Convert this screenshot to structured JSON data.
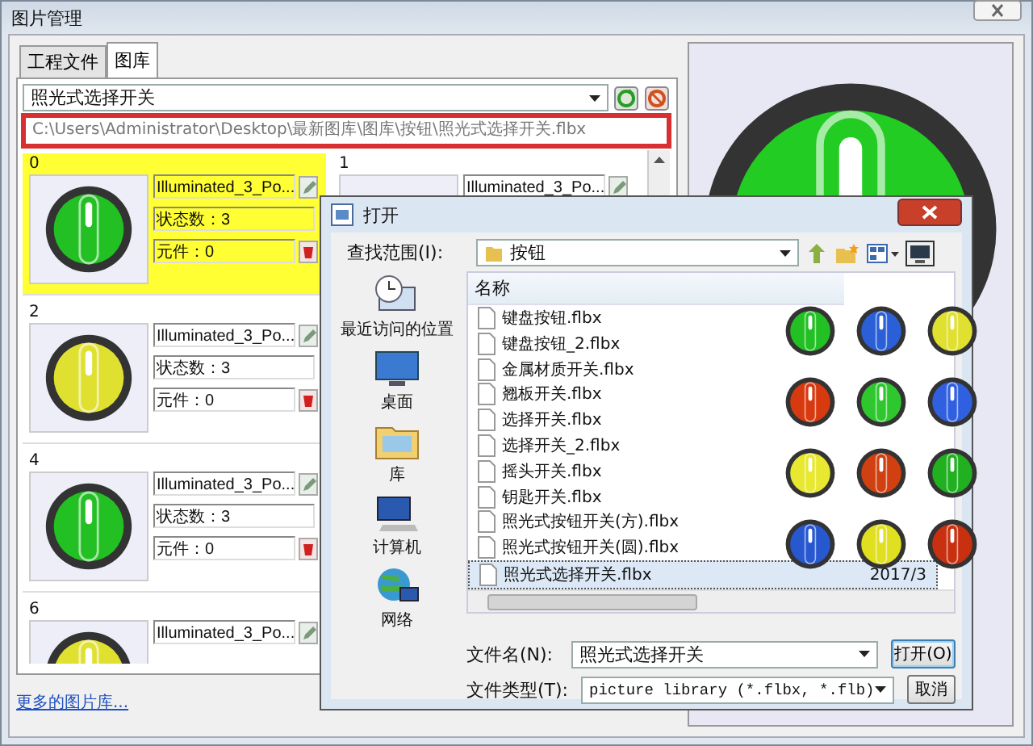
{
  "window": {
    "title": "图片管理"
  },
  "tabs": [
    {
      "label": "工程文件",
      "selected": false
    },
    {
      "label": "图库",
      "selected": true
    }
  ],
  "library": {
    "value": "照光式选择开关"
  },
  "path": {
    "value": "C:\\Users\\Administrator\\Desktop\\最新图库\\图库\\按钮\\照光式选择开关.flbx",
    "highlighted": true
  },
  "grid": {
    "columns": [
      {
        "items": [
          {
            "index": "0",
            "name": "Illuminated_3_Po...",
            "states": "状态数：3",
            "parts": "元件：0",
            "selected": true,
            "color": "#22c022"
          },
          {
            "index": "2",
            "name": "Illuminated_3_Po...",
            "states": "状态数：3",
            "parts": "元件：0",
            "selected": false,
            "color": "#e0e030"
          },
          {
            "index": "4",
            "name": "Illuminated_3_Po...",
            "states": "状态数：3",
            "parts": "元件：0",
            "selected": false,
            "color": "#22c022"
          },
          {
            "index": "6",
            "name": "Illuminated_3_Po...",
            "selected": false,
            "color": "#e0e030"
          }
        ]
      },
      {
        "items": [
          {
            "index": "1",
            "name": "Illuminated_3_Po...",
            "selected": false
          }
        ]
      }
    ]
  },
  "more_link": "更多的图片库...",
  "dialog": {
    "title": "打开",
    "look_in_label": "查找范围(I):",
    "look_in_value": "按钮",
    "places": [
      {
        "label": "最近访问的位置"
      },
      {
        "label": "桌面"
      },
      {
        "label": "库"
      },
      {
        "label": "计算机"
      },
      {
        "label": "网络"
      }
    ],
    "column_header": "名称",
    "files": [
      {
        "name": "键盘按钮.flbx",
        "selected": false
      },
      {
        "name": "键盘按钮_2.flbx",
        "selected": false
      },
      {
        "name": "金属材质开关.flbx",
        "selected": false
      },
      {
        "name": "翘板开关.flbx",
        "selected": false
      },
      {
        "name": "选择开关.flbx",
        "selected": false
      },
      {
        "name": "选择开关_2.flbx",
        "selected": false
      },
      {
        "name": "摇头开关.flbx",
        "selected": false
      },
      {
        "name": "钥匙开关.flbx",
        "selected": false
      },
      {
        "name": "照光式按钮开关(方).flbx",
        "selected": false
      },
      {
        "name": "照光式按钮开关(圆).flbx",
        "selected": false
      },
      {
        "name": "照光式选择开关.flbx",
        "date": "2017/3",
        "selected": true
      }
    ],
    "thumbnails": [
      {
        "color": "#22c022"
      },
      {
        "color": "#2a5fd8"
      },
      {
        "color": "#e0e030"
      },
      {
        "color": "#d83a10"
      },
      {
        "color": "#2ec82e"
      },
      {
        "color": "#3060e0"
      },
      {
        "color": "#e8e830"
      },
      {
        "color": "#d04010"
      },
      {
        "color": "#20b020"
      },
      {
        "color": "#2858d0"
      },
      {
        "color": "#e0e020"
      },
      {
        "color": "#c83010"
      }
    ],
    "filename_label": "文件名(N):",
    "filename_value": "照光式选择开关",
    "filetype_label": "文件类型(T):",
    "filetype_value": "picture library (*.flbx, *.flb)",
    "buttons": [
      {
        "label": "打开(O)",
        "default": true
      },
      {
        "label": "取消",
        "default": false
      }
    ]
  }
}
